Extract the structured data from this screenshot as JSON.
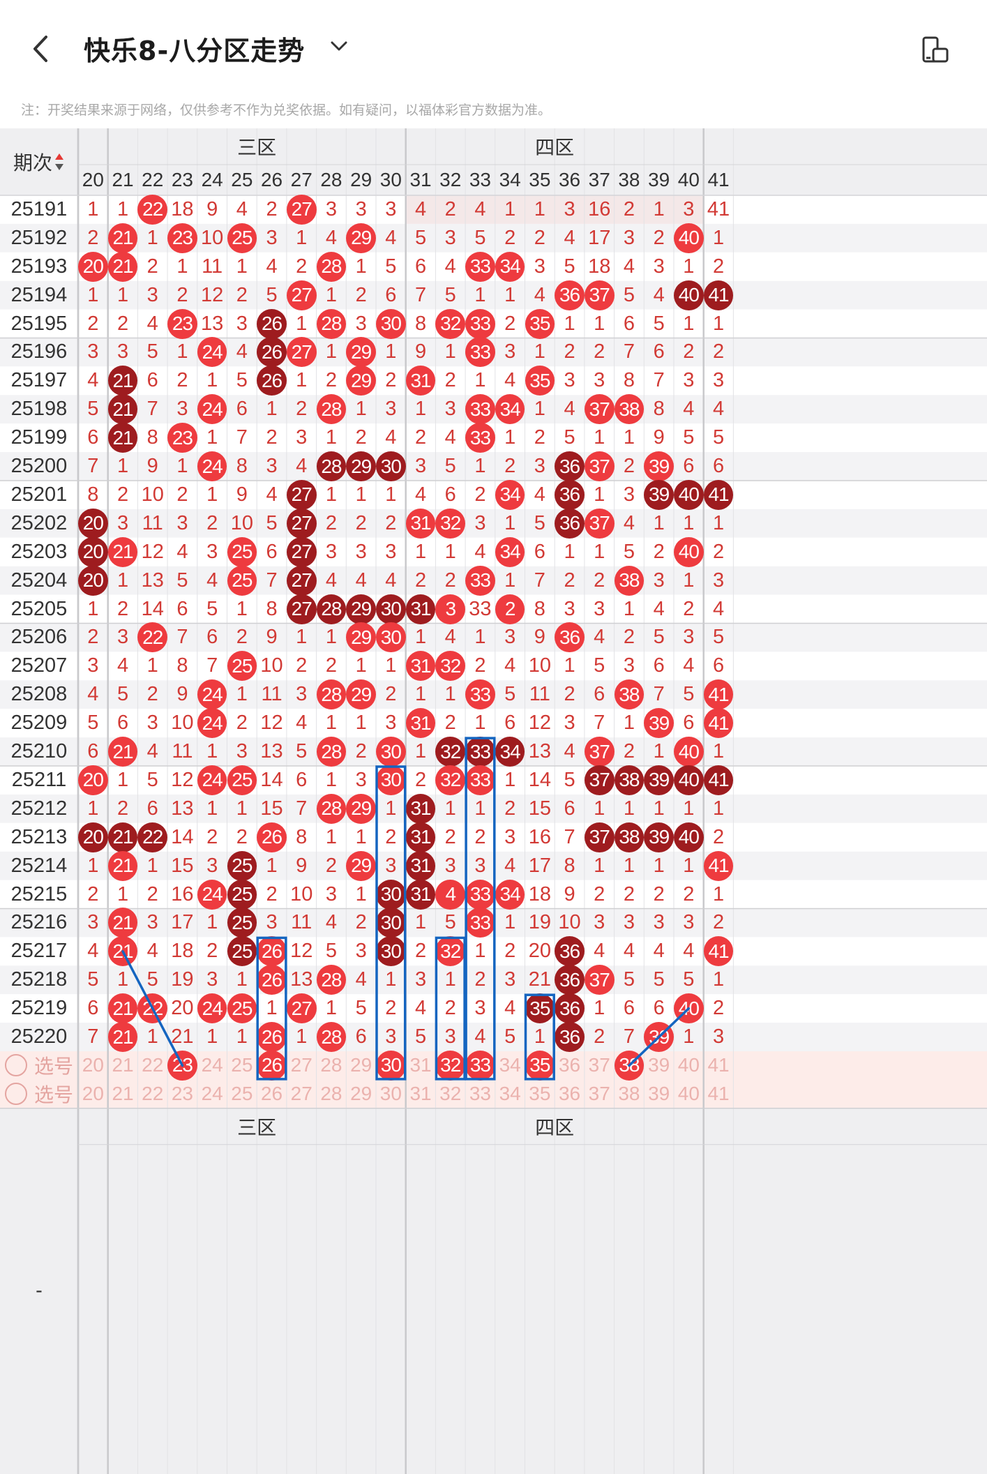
{
  "header": {
    "title": "快乐8-八分区走势",
    "back_icon": "chevron-left-icon",
    "dropdown_icon": "chevron-down-icon",
    "rotate_icon": "screen-rotate-icon"
  },
  "note": "注：开奖结果来源于网络，仅供参考不作为兑奖依据。如有疑问，以福体彩官方数据为准。",
  "table": {
    "period_header": "期次",
    "sort_icon": "sort-updown-icon",
    "zones": [
      {
        "label": "三区"
      },
      {
        "label": "四区"
      }
    ],
    "columns": [
      "20",
      "21",
      "22",
      "23",
      "24",
      "25",
      "26",
      "27",
      "28",
      "29",
      "30",
      "31",
      "32",
      "33",
      "34",
      "35",
      "36",
      "37",
      "38",
      "39",
      "40",
      "41"
    ],
    "rows": [
      {
        "period": "25191",
        "cells": [
          "1",
          "1",
          "22",
          "18",
          "9",
          "4",
          "2",
          "27",
          "3",
          "3",
          "3",
          "4",
          "2",
          "4",
          "1",
          "1",
          "3",
          "16",
          "2",
          "1",
          "3",
          "41"
        ],
        "marks": "00100001000000000000001"
      },
      {
        "period": "25192",
        "cells": [
          "2",
          "21",
          "1",
          "23",
          "10",
          "25",
          "3",
          "1",
          "4",
          "29",
          "4",
          "5",
          "3",
          "5",
          "2",
          "2",
          "4",
          "17",
          "3",
          "2",
          "40",
          "1"
        ],
        "marks": "0101010001000000000010"
      },
      {
        "period": "25193",
        "cells": [
          "20",
          "21",
          "2",
          "1",
          "11",
          "1",
          "4",
          "2",
          "28",
          "1",
          "5",
          "6",
          "4",
          "33",
          "34",
          "3",
          "5",
          "18",
          "4",
          "3",
          "1",
          "2"
        ],
        "marks": "1100000010000110000000"
      },
      {
        "period": "25194",
        "cells": [
          "1",
          "1",
          "3",
          "2",
          "12",
          "2",
          "5",
          "27",
          "1",
          "2",
          "6",
          "7",
          "5",
          "1",
          "1",
          "4",
          "36",
          "37",
          "5",
          "4",
          "40",
          "41"
        ],
        "marks": "0000000100000000110022"
      },
      {
        "period": "25195",
        "cells": [
          "2",
          "2",
          "4",
          "23",
          "13",
          "3",
          "26",
          "1",
          "28",
          "3",
          "30",
          "8",
          "32",
          "33",
          "2",
          "35",
          "1",
          "1",
          "6",
          "5",
          "1",
          "1"
        ],
        "marks": "0001002010101101000000"
      },
      {
        "period": "25196",
        "cells": [
          "3",
          "3",
          "5",
          "1",
          "24",
          "4",
          "26",
          "27",
          "1",
          "29",
          "1",
          "9",
          "1",
          "33",
          "3",
          "1",
          "2",
          "2",
          "7",
          "6",
          "2",
          "2"
        ],
        "marks": "0000102101000100000000"
      },
      {
        "period": "25197",
        "cells": [
          "4",
          "21",
          "6",
          "2",
          "1",
          "5",
          "26",
          "1",
          "2",
          "29",
          "2",
          "31",
          "2",
          "1",
          "4",
          "35",
          "3",
          "3",
          "8",
          "7",
          "3",
          "3"
        ],
        "marks": "0200002001010001000000"
      },
      {
        "period": "25198",
        "cells": [
          "5",
          "21",
          "7",
          "3",
          "24",
          "6",
          "1",
          "2",
          "28",
          "1",
          "3",
          "1",
          "3",
          "33",
          "34",
          "1",
          "4",
          "37",
          "38",
          "8",
          "4",
          "4"
        ],
        "marks": "0200100010000110011000"
      },
      {
        "period": "25199",
        "cells": [
          "6",
          "21",
          "8",
          "23",
          "1",
          "7",
          "2",
          "3",
          "1",
          "2",
          "4",
          "2",
          "4",
          "33",
          "1",
          "2",
          "5",
          "1",
          "1",
          "9",
          "5",
          "5"
        ],
        "marks": "0201000000000100000000"
      },
      {
        "period": "25200",
        "cells": [
          "7",
          "1",
          "9",
          "1",
          "24",
          "8",
          "3",
          "4",
          "28",
          "29",
          "30",
          "3",
          "5",
          "1",
          "2",
          "3",
          "36",
          "37",
          "2",
          "39",
          "6",
          "6"
        ],
        "marks": "0000100022200000210100"
      },
      {
        "period": "25201",
        "cells": [
          "8",
          "2",
          "10",
          "2",
          "1",
          "9",
          "4",
          "27",
          "1",
          "1",
          "1",
          "4",
          "6",
          "2",
          "34",
          "4",
          "36",
          "1",
          "3",
          "39",
          "40",
          "41"
        ],
        "marks": "0000000200000010200222"
      },
      {
        "period": "25202",
        "cells": [
          "20",
          "3",
          "11",
          "3",
          "2",
          "10",
          "5",
          "27",
          "2",
          "2",
          "2",
          "31",
          "32",
          "3",
          "1",
          "5",
          "36",
          "37",
          "4",
          "1",
          "1",
          "1"
        ],
        "marks": "2000000200011000210000"
      },
      {
        "period": "25203",
        "cells": [
          "20",
          "21",
          "12",
          "4",
          "3",
          "25",
          "6",
          "27",
          "3",
          "3",
          "3",
          "1",
          "1",
          "4",
          "34",
          "6",
          "1",
          "1",
          "5",
          "2",
          "40",
          "2"
        ],
        "marks": "2100010200000010000010"
      },
      {
        "period": "25204",
        "cells": [
          "20",
          "1",
          "13",
          "5",
          "4",
          "25",
          "7",
          "27",
          "4",
          "4",
          "4",
          "2",
          "2",
          "33",
          "1",
          "7",
          "2",
          "2",
          "38",
          "3",
          "1",
          "3"
        ],
        "marks": "2000010200000100001000"
      },
      {
        "period": "25205",
        "cells": [
          "1",
          "2",
          "14",
          "6",
          "5",
          "1",
          "8",
          "27",
          "28",
          "29",
          "30",
          "31",
          "3",
          "33",
          "2",
          "8",
          "3",
          "3",
          "1",
          "4",
          "2",
          "4"
        ],
        "marks": "0000000222221010000000"
      },
      {
        "period": "25206",
        "cells": [
          "2",
          "3",
          "22",
          "7",
          "6",
          "2",
          "9",
          "1",
          "1",
          "29",
          "30",
          "1",
          "4",
          "1",
          "3",
          "9",
          "36",
          "4",
          "2",
          "5",
          "3",
          "5"
        ],
        "marks": "0010000001100000100000"
      },
      {
        "period": "25207",
        "cells": [
          "3",
          "4",
          "1",
          "8",
          "7",
          "25",
          "10",
          "2",
          "2",
          "1",
          "1",
          "31",
          "32",
          "2",
          "4",
          "10",
          "1",
          "5",
          "3",
          "6",
          "4",
          "6"
        ],
        "marks": "0000010000011000000000"
      },
      {
        "period": "25208",
        "cells": [
          "4",
          "5",
          "2",
          "9",
          "24",
          "1",
          "11",
          "3",
          "28",
          "29",
          "2",
          "1",
          "1",
          "33",
          "5",
          "11",
          "2",
          "6",
          "38",
          "7",
          "5",
          "41"
        ],
        "marks": "0000100011000100001001"
      },
      {
        "period": "25209",
        "cells": [
          "5",
          "6",
          "3",
          "10",
          "24",
          "2",
          "12",
          "4",
          "1",
          "1",
          "3",
          "31",
          "2",
          "1",
          "6",
          "12",
          "3",
          "7",
          "1",
          "39",
          "6",
          "41"
        ],
        "marks": "0000100000010000000101"
      },
      {
        "period": "25210",
        "cells": [
          "6",
          "21",
          "4",
          "11",
          "1",
          "3",
          "13",
          "5",
          "28",
          "2",
          "30",
          "1",
          "32",
          "33",
          "34",
          "13",
          "4",
          "37",
          "2",
          "1",
          "40",
          "1"
        ],
        "marks": "0100000010102220010010"
      },
      {
        "period": "25211",
        "cells": [
          "20",
          "1",
          "5",
          "12",
          "24",
          "25",
          "14",
          "6",
          "1",
          "3",
          "30",
          "2",
          "32",
          "33",
          "1",
          "14",
          "5",
          "37",
          "38",
          "39",
          "40",
          "41"
        ],
        "marks": "1000110000101100022222"
      },
      {
        "period": "25212",
        "cells": [
          "1",
          "2",
          "6",
          "13",
          "1",
          "1",
          "15",
          "7",
          "28",
          "29",
          "1",
          "31",
          "1",
          "1",
          "2",
          "15",
          "6",
          "1",
          "1",
          "1",
          "1",
          "1"
        ],
        "marks": "0000000011020000000000"
      },
      {
        "period": "25213",
        "cells": [
          "20",
          "21",
          "22",
          "14",
          "2",
          "2",
          "26",
          "8",
          "1",
          "1",
          "2",
          "31",
          "2",
          "2",
          "3",
          "16",
          "7",
          "37",
          "38",
          "39",
          "40",
          "2"
        ],
        "marks": "2220001000020000022220"
      },
      {
        "period": "25214",
        "cells": [
          "1",
          "21",
          "1",
          "15",
          "3",
          "25",
          "1",
          "9",
          "2",
          "29",
          "3",
          "31",
          "3",
          "3",
          "4",
          "17",
          "8",
          "1",
          "1",
          "1",
          "1",
          "41"
        ],
        "marks": "0100020001020000000001"
      },
      {
        "period": "25215",
        "cells": [
          "2",
          "1",
          "2",
          "16",
          "24",
          "25",
          "2",
          "10",
          "3",
          "1",
          "30",
          "31",
          "4",
          "33",
          "34",
          "18",
          "9",
          "2",
          "2",
          "2",
          "2",
          "1"
        ],
        "marks": "0000120000221110000000"
      },
      {
        "period": "25216",
        "cells": [
          "3",
          "21",
          "3",
          "17",
          "1",
          "25",
          "3",
          "11",
          "4",
          "2",
          "30",
          "1",
          "5",
          "33",
          "1",
          "19",
          "10",
          "3",
          "3",
          "3",
          "3",
          "2"
        ],
        "marks": "0100020000200100000000"
      },
      {
        "period": "25217",
        "cells": [
          "4",
          "21",
          "4",
          "18",
          "2",
          "25",
          "26",
          "12",
          "5",
          "3",
          "30",
          "2",
          "32",
          "1",
          "2",
          "20",
          "36",
          "4",
          "4",
          "4",
          "4",
          "41"
        ],
        "marks": "0100021000201000200001"
      },
      {
        "period": "25218",
        "cells": [
          "5",
          "1",
          "5",
          "19",
          "3",
          "1",
          "26",
          "13",
          "28",
          "4",
          "1",
          "3",
          "1",
          "2",
          "3",
          "21",
          "36",
          "37",
          "5",
          "5",
          "5",
          "1"
        ],
        "marks": "0000001010000000210000"
      },
      {
        "period": "25219",
        "cells": [
          "6",
          "21",
          "22",
          "20",
          "24",
          "25",
          "1",
          "27",
          "1",
          "5",
          "2",
          "4",
          "2",
          "3",
          "4",
          "35",
          "36",
          "1",
          "6",
          "6",
          "40",
          "2"
        ],
        "marks": "0110110100000002200010"
      },
      {
        "period": "25220",
        "cells": [
          "7",
          "21",
          "1",
          "21",
          "1",
          "1",
          "26",
          "1",
          "28",
          "6",
          "3",
          "5",
          "3",
          "4",
          "5",
          "1",
          "36",
          "2",
          "7",
          "39",
          "1",
          "3"
        ],
        "marks": "0100001010000000200100"
      }
    ],
    "pick_rows": [
      {
        "label": "选号",
        "selected": {
          "23": "red",
          "26": "red",
          "30": "red",
          "32": "red",
          "33": "red",
          "35": "red",
          "38": "red"
        }
      },
      {
        "label": "选号",
        "selected": {}
      }
    ],
    "footer_zone_labels": [
      "三区",
      "四区"
    ],
    "footer_first_cell": "-",
    "colors": {
      "red_ball": "#ee3b3f",
      "dark_ball": "#9e1c1f",
      "number_text": "#d23a35",
      "box_outline": "#1565c0",
      "pick_bg": "#fdece9"
    }
  }
}
